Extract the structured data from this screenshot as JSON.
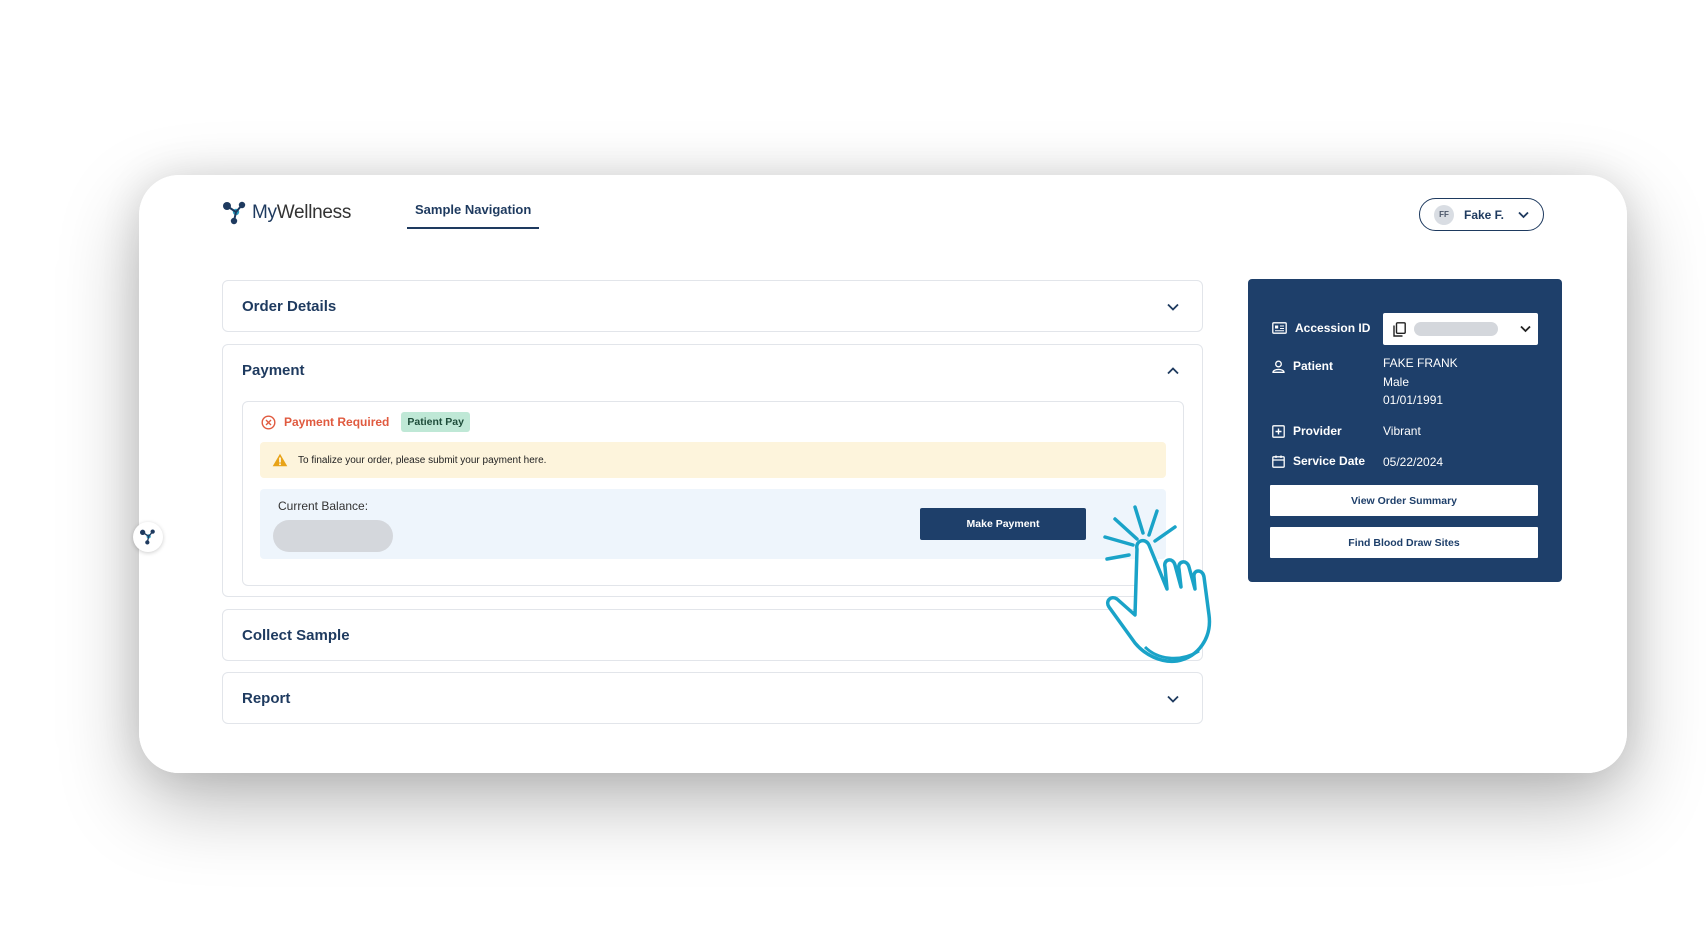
{
  "brand": {
    "name_part1": "My",
    "name_part2": "Wellness"
  },
  "nav": {
    "tab_label": "Sample Navigation"
  },
  "user": {
    "initials": "FF",
    "name": "Fake F."
  },
  "sections": {
    "order_details": {
      "title": "Order Details"
    },
    "payment": {
      "title": "Payment",
      "status": "Payment Required",
      "badge": "Patient Pay",
      "alert": "To finalize your order, please submit your payment here.",
      "balance_label": "Current Balance:",
      "pay_button": "Make Payment"
    },
    "collect_sample": {
      "title": "Collect Sample"
    },
    "report": {
      "title": "Report"
    }
  },
  "side_panel": {
    "accession_label": "Accession ID",
    "patient_label": "Patient",
    "patient_name": "FAKE FRANK",
    "patient_sex": "Male",
    "patient_dob": "01/01/1991",
    "provider_label": "Provider",
    "provider_value": "Vibrant",
    "service_date_label": "Service Date",
    "service_date_value": "05/22/2024",
    "view_summary_button": "View Order Summary",
    "find_sites_button": "Find Blood Draw Sites"
  },
  "colors": {
    "primary": "#1e3f6a",
    "error": "#e05a3f",
    "badge_bg": "#bfe8d6",
    "alert_bg": "#fdf4dc",
    "hand_stroke": "#1aa3c8"
  }
}
